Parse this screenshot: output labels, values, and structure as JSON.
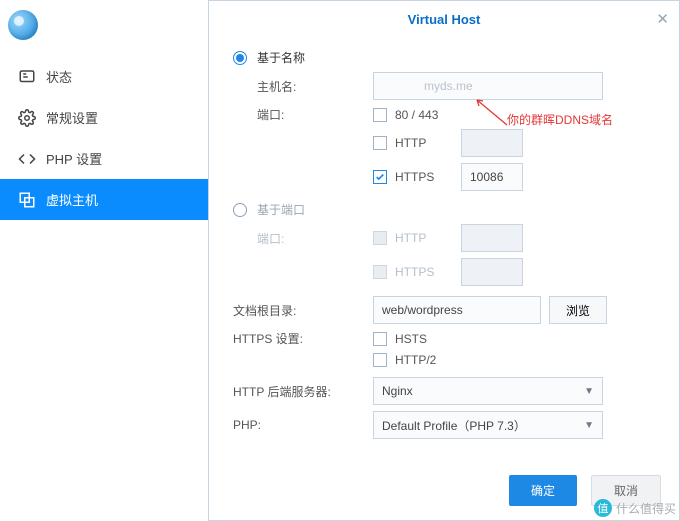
{
  "sidebar": {
    "items": [
      {
        "label": "状态"
      },
      {
        "label": "常规设置"
      },
      {
        "label": "PHP 设置"
      },
      {
        "label": "虚拟主机"
      }
    ]
  },
  "panel": {
    "title": "Virtual Host"
  },
  "form": {
    "based_name_label": "基于名称",
    "hostname_label": "主机名:",
    "hostname_value": "myds.me",
    "port_label": "端口:",
    "port_default_text": "80 / 443",
    "http_label": "HTTP",
    "https_label": "HTTPS",
    "https_port_value": "10086",
    "based_port_label": "基于端口",
    "based_port_port_label": "端口:",
    "docroot_label": "文档根目录:",
    "docroot_value": "web/wordpress",
    "browse_label": "浏览",
    "https_settings_label": "HTTPS 设置:",
    "hsts_label": "HSTS",
    "http2_label": "HTTP/2",
    "backend_label": "HTTP 后端服务器:",
    "backend_value": "Nginx",
    "php_label": "PHP:",
    "php_value": "Default Profile（PHP 7.3）"
  },
  "annotation": {
    "text": "你的群晖DDNS域名"
  },
  "buttons": {
    "ok": "确定",
    "cancel": "取消"
  },
  "watermark": {
    "badge": "值",
    "text": "什么值得买"
  }
}
